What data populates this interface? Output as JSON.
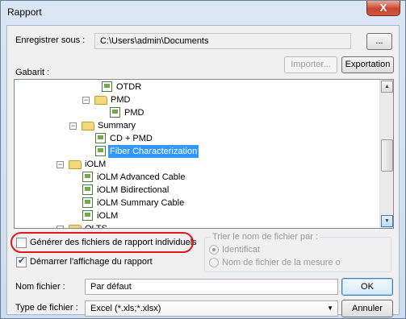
{
  "window": {
    "title": "Rapport",
    "close_glyph": "X"
  },
  "save": {
    "label": "Enregistrer sous :",
    "path": "C:\\Users\\admin\\Documents",
    "browse_label": "..."
  },
  "template": {
    "label": "Gabarit :",
    "import_label": "Importer...",
    "export_label": "Exportation"
  },
  "tree": {
    "items": [
      {
        "label": "OTDR",
        "type": "doc"
      },
      {
        "label": "PMD",
        "type": "folder",
        "toggle": "−"
      },
      {
        "label": "PMD",
        "type": "doc"
      },
      {
        "label": "Summary",
        "type": "folder",
        "toggle": "−"
      },
      {
        "label": "CD + PMD",
        "type": "doc"
      },
      {
        "label": "Fiber Characterization",
        "type": "doc",
        "selected": true
      },
      {
        "label": "iOLM",
        "type": "folder",
        "toggle": "−"
      },
      {
        "label": "iOLM Advanced Cable",
        "type": "doc"
      },
      {
        "label": "iOLM Bidirectional",
        "type": "doc"
      },
      {
        "label": "iOLM Summary Cable",
        "type": "doc"
      },
      {
        "label": "iOLM",
        "type": "doc"
      },
      {
        "label": "OLTS",
        "type": "folder",
        "toggle": "−"
      }
    ]
  },
  "options": {
    "individual_reports_label": "Générer des fichiers de rapport individuels",
    "individual_reports_checked": false,
    "start_display_label": "Démarrer l'affichage du rapport",
    "start_display_checked": true
  },
  "sort": {
    "label": "Trier le nom de fichier par :",
    "option_identifier": "Identificat",
    "option_measure": "Nom de fichier de la mesure o",
    "selected": "Identificat"
  },
  "filename": {
    "label": "Nom fichier :",
    "value": "Par défaut",
    "ok_label": "OK"
  },
  "filetype": {
    "label": "Type de fichier :",
    "value": "Excel (*.xls;*.xlsx)",
    "cancel_label": "Annuler"
  },
  "colors": {
    "highlight": "#e0191f",
    "selection": "#3399ff"
  }
}
